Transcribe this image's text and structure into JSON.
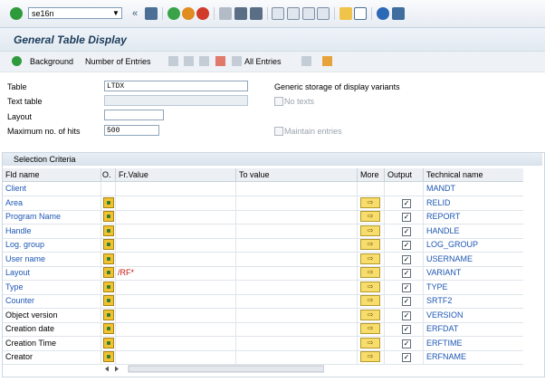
{
  "toolbar": {
    "command_value": "se16n",
    "icons": [
      "enter-icon",
      "back-icon",
      "save-icon",
      "back-green-icon",
      "exit-icon",
      "cancel-icon",
      "print-icon",
      "find-icon",
      "find-next-icon",
      "first-page-icon",
      "prev-page-icon",
      "next-page-icon",
      "last-page-icon",
      "new-session-icon",
      "shortcut-icon",
      "help-icon",
      "layout-icon"
    ]
  },
  "title": "General Table Display",
  "app_toolbar": {
    "background": "Background",
    "number_of_entries": "Number of Entries",
    "all_entries": "All Entries"
  },
  "form": {
    "table_label": "Table",
    "table_value": "LTDX",
    "text_table_label": "Text table",
    "layout_label": "Layout",
    "max_hits_label": "Maximum no. of hits",
    "max_hits_value": "500",
    "generic_storage": "Generic storage of display variants",
    "no_texts": "No texts",
    "maintain_entries": "Maintain entries"
  },
  "selection": {
    "header": "Selection Criteria",
    "columns": [
      "Fld name",
      "O.",
      "Fr.Value",
      "To value",
      "More",
      "Output",
      "Technical name"
    ],
    "rows": [
      {
        "name": "Client",
        "from": "",
        "tech": "MANDT",
        "link": true,
        "controls": false
      },
      {
        "name": "Area",
        "from": "",
        "tech": "RELID",
        "link": true,
        "controls": true
      },
      {
        "name": "Program Name",
        "from": "",
        "tech": "REPORT",
        "link": true,
        "controls": true
      },
      {
        "name": "Handle",
        "from": "",
        "tech": "HANDLE",
        "link": true,
        "controls": true
      },
      {
        "name": "Log. group",
        "from": "",
        "tech": "LOG_GROUP",
        "link": true,
        "controls": true
      },
      {
        "name": "User name",
        "from": "",
        "tech": "USERNAME",
        "link": true,
        "controls": true
      },
      {
        "name": "Layout",
        "from": "/RF*",
        "tech": "VARIANT",
        "link": true,
        "controls": true
      },
      {
        "name": "Type",
        "from": "",
        "tech": "TYPE",
        "link": true,
        "controls": true
      },
      {
        "name": "Counter",
        "from": "",
        "tech": "SRTF2",
        "link": true,
        "controls": true
      },
      {
        "name": "Object version",
        "from": "",
        "tech": "VERSION",
        "link": false,
        "controls": true
      },
      {
        "name": "Creation date",
        "from": "",
        "tech": "ERFDAT",
        "link": false,
        "controls": true
      },
      {
        "name": "Creation Time",
        "from": "",
        "tech": "ERFTIME",
        "link": false,
        "controls": true
      },
      {
        "name": "Creator",
        "from": "",
        "tech": "ERFNAME",
        "link": false,
        "controls": true
      }
    ]
  }
}
